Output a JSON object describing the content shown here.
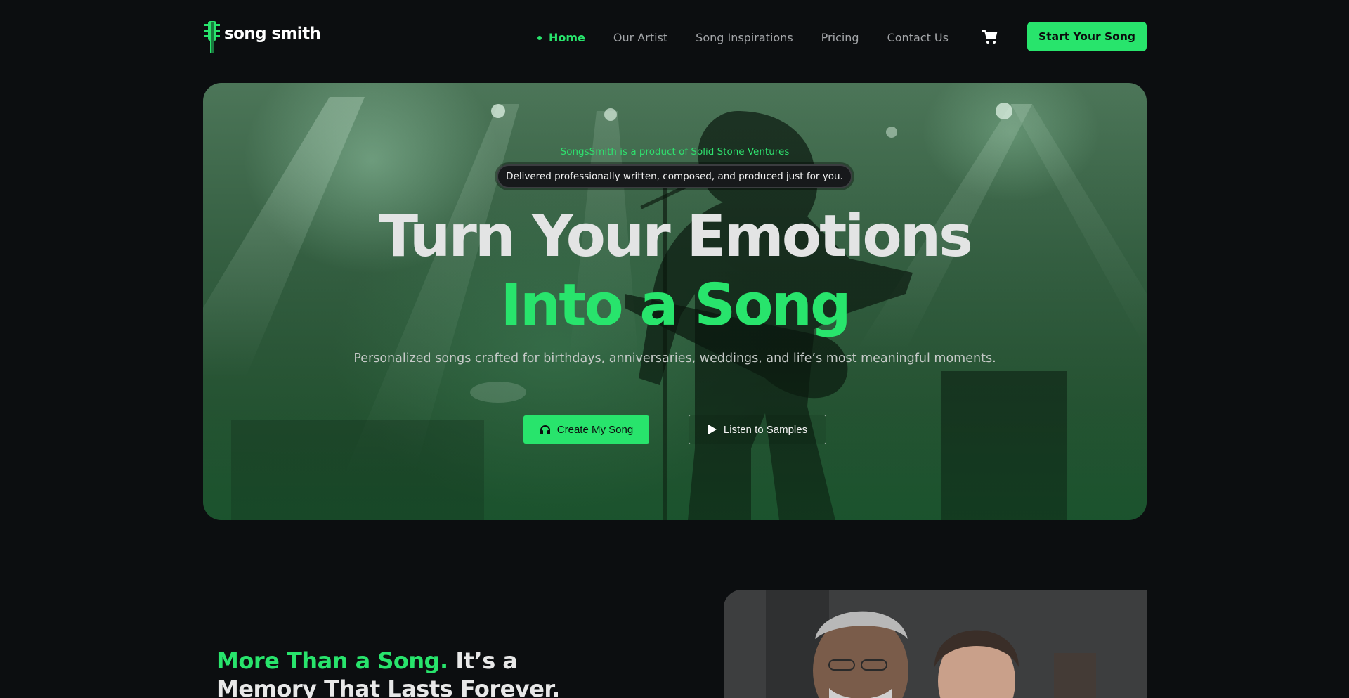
{
  "brand": {
    "name": "song smith",
    "accent": "#28e46c"
  },
  "nav": {
    "links": [
      {
        "label": "Home",
        "active": true
      },
      {
        "label": "Our Artist"
      },
      {
        "label": "Song Inspirations"
      },
      {
        "label": "Pricing"
      },
      {
        "label": "Contact Us"
      }
    ],
    "cart_icon": "cart-icon",
    "cta": "Start Your Song"
  },
  "hero": {
    "eyebrow": "SongsSmith is a product of Solid Stone Ventures",
    "pill": "Delivered professionally written, composed, and produced just for you.",
    "title_line1": "Turn Your Emotions",
    "title_line2": "Into a Song",
    "subtitle": "Personalized songs crafted for birthdays, anniversaries, weddings, and life’s most meaningful moments.",
    "primary_button": {
      "label": "Create My Song",
      "icon": "headphones-icon"
    },
    "secondary_button": {
      "label": "Listen to Samples",
      "icon": "play-icon"
    }
  },
  "section2": {
    "heading_accent": "More Than a Song.",
    "heading_rest": " It’s a Memory That Lasts Forever."
  }
}
